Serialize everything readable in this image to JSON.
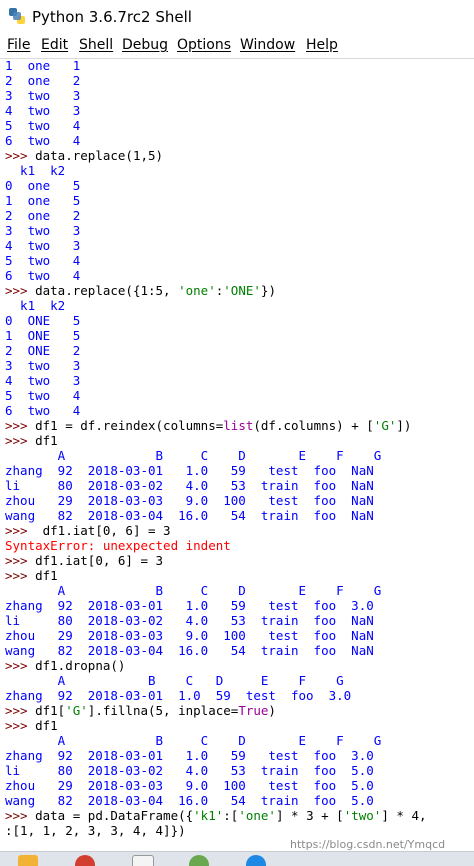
{
  "window": {
    "title": "Python 3.6.7rc2 Shell"
  },
  "menu": [
    "File",
    "Edit",
    "Shell",
    "Debug",
    "Options",
    "Window",
    "Help"
  ],
  "console_lines": [
    {
      "type": "out",
      "text": "1  one   1"
    },
    {
      "type": "out",
      "text": "2  one   2"
    },
    {
      "type": "out",
      "text": "3  two   3"
    },
    {
      "type": "out",
      "text": "4  two   3"
    },
    {
      "type": "out",
      "text": "5  two   4"
    },
    {
      "type": "out",
      "text": "6  two   4"
    },
    {
      "type": "in",
      "text": "data.replace(1,5)"
    },
    {
      "type": "out",
      "text": "  k1  k2"
    },
    {
      "type": "out",
      "text": "0  one   5"
    },
    {
      "type": "out",
      "text": "1  one   5"
    },
    {
      "type": "out",
      "text": "2  one   2"
    },
    {
      "type": "out",
      "text": "3  two   3"
    },
    {
      "type": "out",
      "text": "4  two   3"
    },
    {
      "type": "out",
      "text": "5  two   4"
    },
    {
      "type": "out",
      "text": "6  two   4"
    },
    {
      "type": "in",
      "text": "data.replace({1:5, 'one':'ONE'})"
    },
    {
      "type": "out",
      "text": "  k1  k2"
    },
    {
      "type": "out",
      "text": "0  ONE   5"
    },
    {
      "type": "out",
      "text": "1  ONE   5"
    },
    {
      "type": "out",
      "text": "2  ONE   2"
    },
    {
      "type": "out",
      "text": "3  two   3"
    },
    {
      "type": "out",
      "text": "4  two   3"
    },
    {
      "type": "out",
      "text": "5  two   4"
    },
    {
      "type": "out",
      "text": "6  two   4"
    },
    {
      "type": "in",
      "text": "df1 = df.reindex(columns=list(df.columns) + ['G'])"
    },
    {
      "type": "in",
      "text": "df1"
    },
    {
      "type": "out",
      "text": "       A            B     C    D       E    F    G"
    },
    {
      "type": "out",
      "text": "zhang  92  2018-03-01   1.0   59   test  foo  NaN"
    },
    {
      "type": "out",
      "text": "li     80  2018-03-02   4.0   53  train  foo  NaN"
    },
    {
      "type": "out",
      "text": "zhou   29  2018-03-03   9.0  100   test  foo  NaN"
    },
    {
      "type": "out",
      "text": "wang   82  2018-03-04  16.0   54  train  foo  NaN"
    },
    {
      "type": "in",
      "text": " df1.iat[0, 6] = 3"
    },
    {
      "type": "err",
      "text": "SyntaxError: unexpected indent"
    },
    {
      "type": "in",
      "text": "df1.iat[0, 6] = 3"
    },
    {
      "type": "in",
      "text": "df1"
    },
    {
      "type": "out",
      "text": "       A            B     C    D       E    F    G"
    },
    {
      "type": "out",
      "text": "zhang  92  2018-03-01   1.0   59   test  foo  3.0"
    },
    {
      "type": "out",
      "text": "li     80  2018-03-02   4.0   53  train  foo  NaN"
    },
    {
      "type": "out",
      "text": "zhou   29  2018-03-03   9.0  100   test  foo  NaN"
    },
    {
      "type": "out",
      "text": "wang   82  2018-03-04  16.0   54  train  foo  NaN"
    },
    {
      "type": "in",
      "text": "df1.dropna()"
    },
    {
      "type": "out",
      "text": "       A           B    C   D     E    F    G"
    },
    {
      "type": "out",
      "text": "zhang  92  2018-03-01  1.0  59  test  foo  3.0"
    },
    {
      "type": "in",
      "text": "df1['G'].fillna(5, inplace=True)"
    },
    {
      "type": "in",
      "text": "df1"
    },
    {
      "type": "out",
      "text": "       A            B     C    D       E    F    G"
    },
    {
      "type": "out",
      "text": "zhang  92  2018-03-01   1.0   59   test  foo  3.0"
    },
    {
      "type": "out",
      "text": "li     80  2018-03-02   4.0   53  train  foo  5.0"
    },
    {
      "type": "out",
      "text": "zhou   29  2018-03-03   9.0  100   test  foo  5.0"
    },
    {
      "type": "out",
      "text": "wang   82  2018-03-04  16.0   54  train  foo  5.0"
    },
    {
      "type": "in",
      "text": "data = pd.DataFrame({'k1':['one'] * 3 + ['two'] * 4,"
    },
    {
      "type": "cont",
      "text": ":[1, 1, 2, 3, 3, 4, 4]})"
    }
  ],
  "prompt": ">>> ",
  "watermark": "https://blog.csdn.net/Ymqcd",
  "colors": {
    "output": "#0000ff",
    "prompt": "#7a0000",
    "keyword": "#990099",
    "string": "#008000",
    "error": "#ff0000"
  }
}
